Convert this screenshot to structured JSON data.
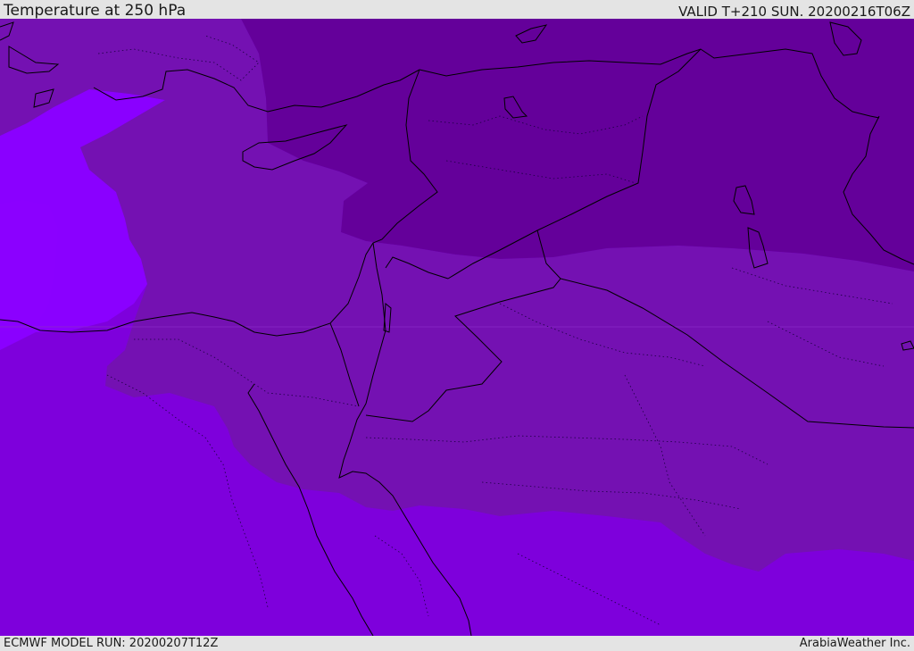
{
  "header": {
    "title": "Temperature at 250 hPa",
    "valid_time": "VALID T+210 SUN. 20200216T06Z"
  },
  "footer": {
    "model_run": "ECMWF MODEL RUN: 20200207T12Z",
    "credit": "ArabiaWeather Inc."
  },
  "colors": {
    "darkest_band": "#64009a",
    "dark_band": "#7411b2",
    "mid_band": "#7e00dc",
    "light_band": "#8a00ff",
    "border_line": "#000000",
    "frame_bg": "#e4e4e4"
  }
}
